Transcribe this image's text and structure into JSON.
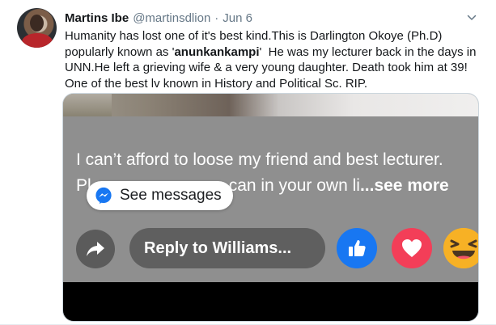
{
  "tweet": {
    "author_name": "Martins Ibe",
    "author_handle": "@martinsdlion",
    "separator": "·",
    "date": "Jun 6",
    "text_part1": "Humanity has lost one of it's best kind.This is Darlington Okoye (Ph.D) popularly known as '",
    "text_bold": "anunkankampi",
    "text_part2": "'  He was my lecturer back in the days in UNN.He left a grieving wife & a very young daughter. Death took him at 39! One of the best lv known in History and Political Sc. RIP."
  },
  "media": {
    "message_line1": "I can’t afford to loose my friend and best lecturer.",
    "message_line2_start": "Pl",
    "message_line2_end": "can in your own li",
    "see_more": "...see more",
    "see_messages_label": "See messages",
    "reply_label": "Reply to Williams..."
  },
  "icons": {
    "caret": "chevron-down-icon",
    "messenger": "messenger-icon",
    "share": "share-arrow-icon",
    "like": "like-thumb-icon",
    "love": "love-heart-icon",
    "haha": "haha-emoji-icon"
  },
  "colors": {
    "messenger_blue": "#1877f2",
    "love_red": "#f33e58",
    "haha_yellow": "#f7b125",
    "meta_gray": "#657786"
  }
}
